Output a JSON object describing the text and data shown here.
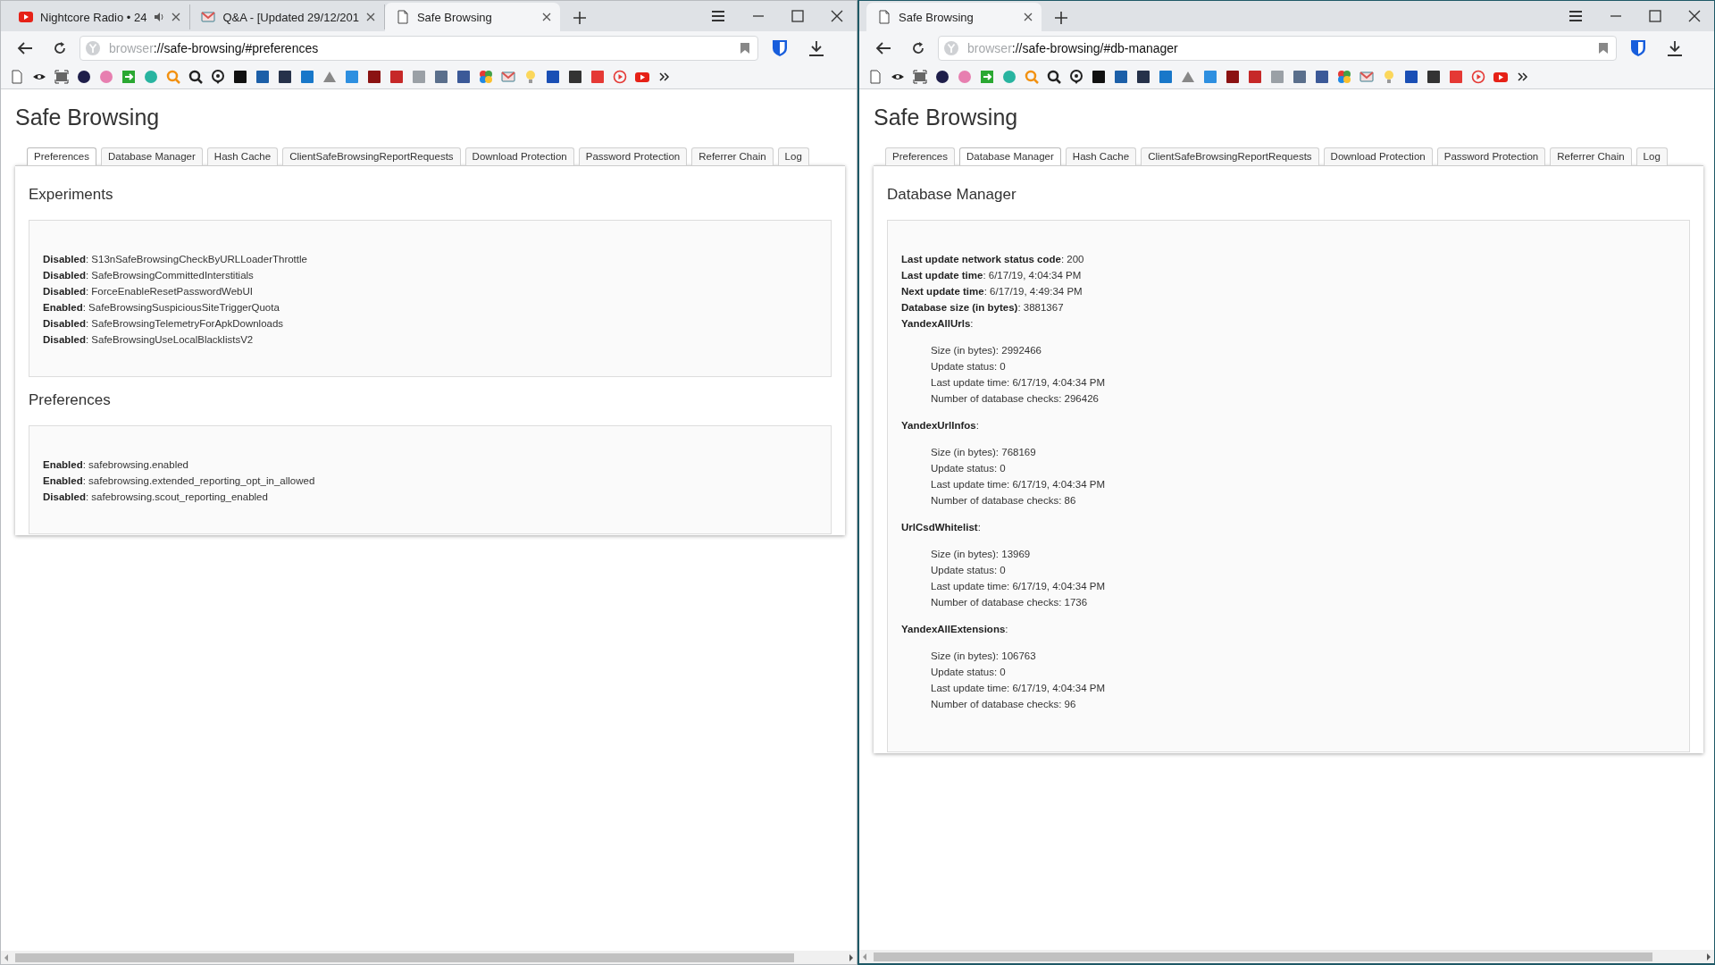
{
  "windows": [
    {
      "active": false,
      "tabs": [
        {
          "kind": "video",
          "title": "Nightcore Radio • 24",
          "audio": true,
          "selected": false
        },
        {
          "kind": "envelope",
          "title": "Q&A - [Updated 29/12/201",
          "audio": false,
          "selected": false
        },
        {
          "kind": "page",
          "title": "Safe Browsing",
          "audio": false,
          "selected": true
        }
      ],
      "address": {
        "scheme": "browser",
        "path": "://safe-browsing/#preferences"
      },
      "page": {
        "title": "Safe Browsing",
        "tabs": [
          {
            "label": "Preferences",
            "selected": true
          },
          {
            "label": "Database Manager",
            "selected": false
          },
          {
            "label": "Hash Cache",
            "selected": false
          },
          {
            "label": "ClientSafeBrowsingReportRequests",
            "selected": false
          },
          {
            "label": "Download Protection",
            "selected": false
          },
          {
            "label": "Password Protection",
            "selected": false
          },
          {
            "label": "Referrer Chain",
            "selected": false
          },
          {
            "label": "Log",
            "selected": false
          }
        ],
        "sections": [
          {
            "heading": "Experiments",
            "entries": [
              {
                "kind": "line",
                "text": "**Disabled**: S13nSafeBrowsingCheckByURLLoaderThrottle"
              },
              {
                "kind": "line",
                "text": "**Disabled**: SafeBrowsingCommittedInterstitials"
              },
              {
                "kind": "line",
                "text": "**Disabled**: ForceEnableResetPasswordWebUI"
              },
              {
                "kind": "line",
                "text": "**Enabled**: SafeBrowsingSuspiciousSiteTriggerQuota"
              },
              {
                "kind": "line",
                "text": "**Disabled**: SafeBrowsingTelemetryForApkDownloads"
              },
              {
                "kind": "line",
                "text": "**Disabled**: SafeBrowsingUseLocalBlacklistsV2"
              }
            ]
          },
          {
            "heading": "Preferences",
            "entries": [
              {
                "kind": "line",
                "text": "**Enabled**: safebrowsing.enabled"
              },
              {
                "kind": "line",
                "text": "**Enabled**: safebrowsing.extended_reporting_opt_in_allowed"
              },
              {
                "kind": "line",
                "text": "**Disabled**: safebrowsing.scout_reporting_enabled"
              }
            ]
          }
        ]
      }
    },
    {
      "active": true,
      "tabs": [
        {
          "kind": "page",
          "title": "Safe Browsing",
          "audio": false,
          "selected": true
        }
      ],
      "address": {
        "scheme": "browser",
        "path": "://safe-browsing/#db-manager"
      },
      "page": {
        "title": "Safe Browsing",
        "tabs": [
          {
            "label": "Preferences",
            "selected": false
          },
          {
            "label": "Database Manager",
            "selected": true
          },
          {
            "label": "Hash Cache",
            "selected": false
          },
          {
            "label": "ClientSafeBrowsingReportRequests",
            "selected": false
          },
          {
            "label": "Download Protection",
            "selected": false
          },
          {
            "label": "Password Protection",
            "selected": false
          },
          {
            "label": "Referrer Chain",
            "selected": false
          },
          {
            "label": "Log",
            "selected": false
          }
        ],
        "sections": [
          {
            "heading": "Database Manager",
            "entries": [
              {
                "kind": "line",
                "text": "**Last update network status code**: 200"
              },
              {
                "kind": "line",
                "text": "**Last update time**: 6/17/19, 4:04:34 PM"
              },
              {
                "kind": "line",
                "text": "**Next update time**: 6/17/19, 4:49:34 PM"
              },
              {
                "kind": "line",
                "text": "**Database size (in bytes)**: 3881367"
              },
              {
                "kind": "group",
                "text": "**YandexAllUrls**:",
                "lines": [
                  "Size (in bytes): 2992466",
                  "Update status: 0",
                  "Last update time: 6/17/19, 4:04:34 PM",
                  "Number of database checks: 296426"
                ]
              },
              {
                "kind": "group",
                "text": "**YandexUrlInfos**:",
                "lines": [
                  "Size (in bytes): 768169",
                  "Update status: 0",
                  "Last update time: 6/17/19, 4:04:34 PM",
                  "Number of database checks: 86"
                ]
              },
              {
                "kind": "group",
                "text": "**UrlCsdWhitelist**:",
                "lines": [
                  "Size (in bytes): 13969",
                  "Update status: 0",
                  "Last update time: 6/17/19, 4:04:34 PM",
                  "Number of database checks: 1736"
                ]
              },
              {
                "kind": "group",
                "text": "**YandexAllExtensions**:",
                "lines": [
                  "Size (in bytes): 106763",
                  "Update status: 0",
                  "Last update time: 6/17/19, 4:04:34 PM",
                  "Number of database checks: 96"
                ]
              }
            ]
          }
        ]
      }
    }
  ]
}
